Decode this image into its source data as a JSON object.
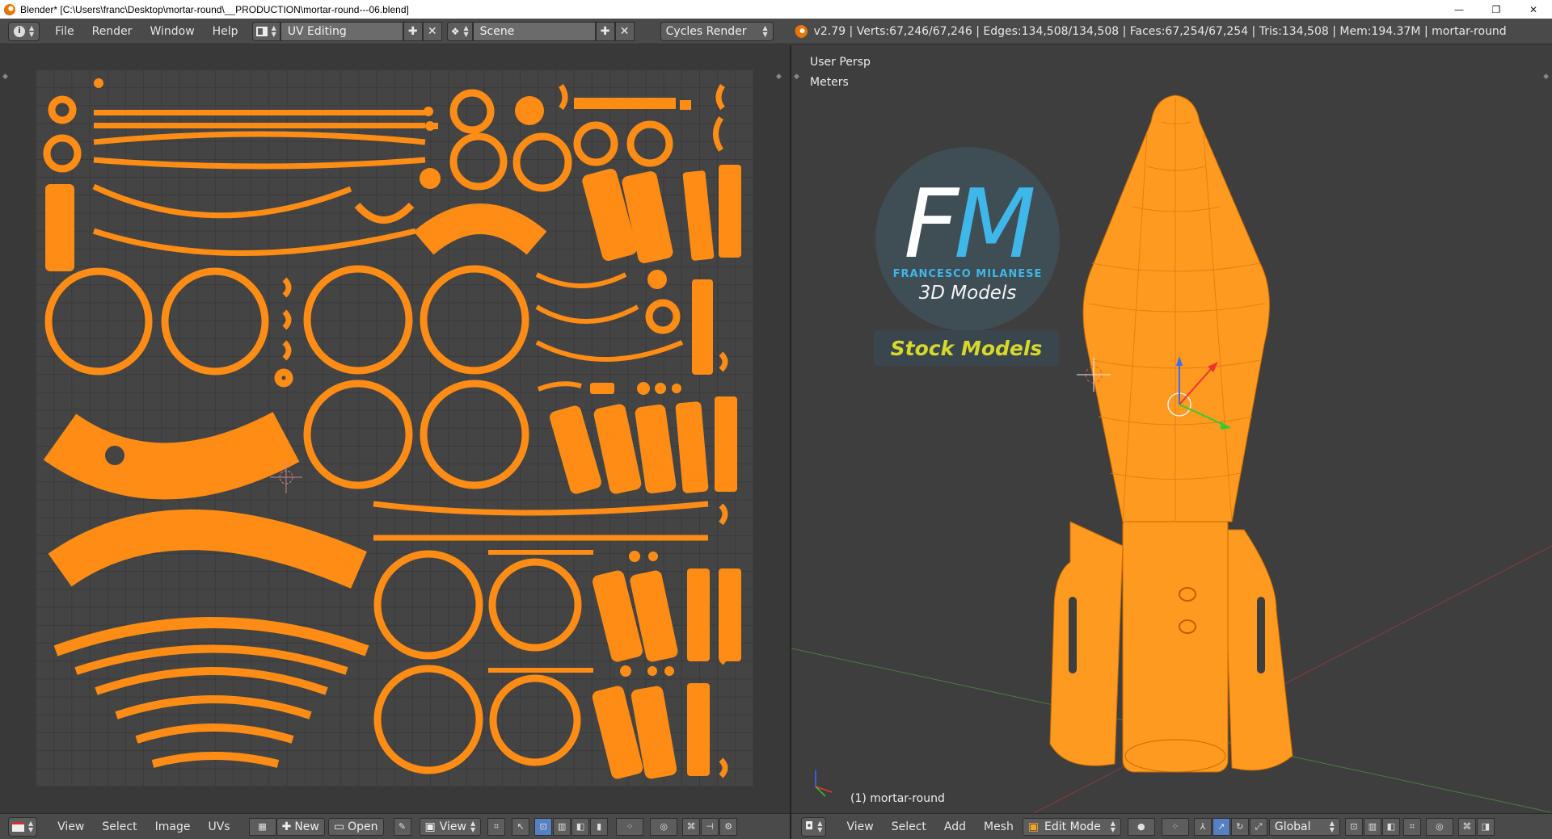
{
  "window": {
    "title": "Blender* [C:\\Users\\franc\\Desktop\\mortar-round\\__PRODUCTION\\mortar-round---06.blend]",
    "minimize": "—",
    "maximize": "❐",
    "close": "✕"
  },
  "info_header": {
    "editor_icon": "info-icon",
    "menus": [
      "File",
      "Render",
      "Window",
      "Help"
    ],
    "layout": "UV Editing",
    "scene": "Scene",
    "engine": "Cycles Render",
    "stats": "v2.79 | Verts:67,246/67,246 | Edges:134,508/134,508 | Faces:67,254/67,254 | Tris:134,508 | Mem:194.37M | mortar-round"
  },
  "uv_editor": {
    "menus": [
      "View",
      "Select",
      "Image",
      "UVs"
    ],
    "new_label": "New",
    "open_label": "Open",
    "view_label": "View",
    "uv_color": "#ff8c14"
  },
  "view3d": {
    "view_name": "User Persp",
    "units": "Meters",
    "object_label": "(1) mortar-round",
    "menus": [
      "View",
      "Select",
      "Add",
      "Mesh"
    ],
    "mode": "Edit Mode",
    "orientation": "Global",
    "logo": {
      "letters_f": "F",
      "letters_m": "M",
      "name": "FRANCESCO MILANESE",
      "subtitle": "3D Models",
      "banner": "Stock Models"
    },
    "mesh_color": "#ff8c14"
  }
}
